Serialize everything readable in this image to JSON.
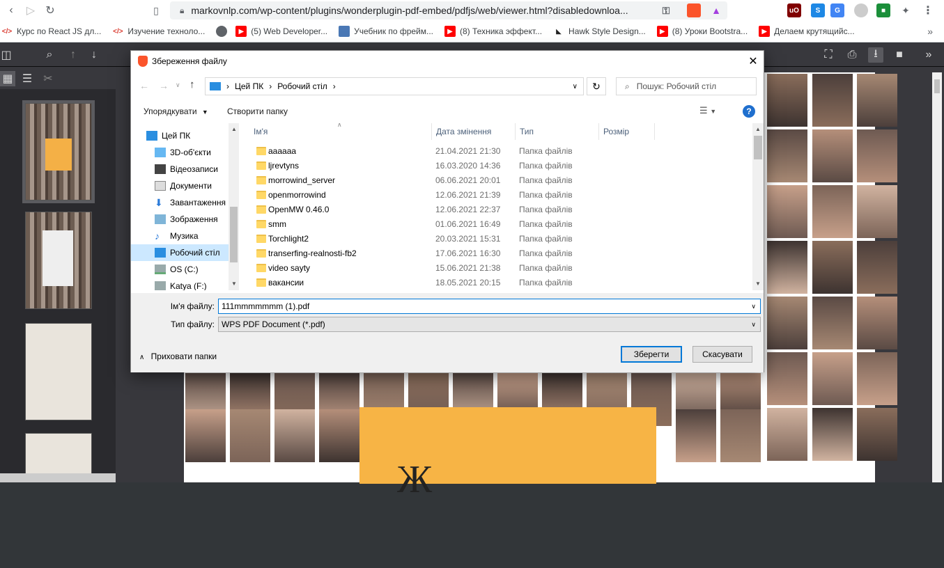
{
  "browser": {
    "url": "markovnlp.com/wp-content/plugins/wonderplugin-pdf-embed/pdfjs/web/viewer.html?disabledownloa..."
  },
  "bookmarks": [
    {
      "label": "Курс по React JS дл...",
      "icon": "code-icon"
    },
    {
      "label": "Изучение техноло...",
      "icon": "code-icon"
    },
    {
      "label": "",
      "icon": "globe-icon"
    },
    {
      "label": "(5) Web Developer...",
      "icon": "youtube-icon"
    },
    {
      "label": "Учебник по фрейм...",
      "icon": "book-icon"
    },
    {
      "label": "(8) Техника эффект...",
      "icon": "youtube-icon"
    },
    {
      "label": "Hawk Style Design...",
      "icon": "hawk-icon"
    },
    {
      "label": "(8) Уроки Bootstra...",
      "icon": "youtube-icon"
    },
    {
      "label": "Делаем крутящийс...",
      "icon": "youtube-icon"
    }
  ],
  "dialog": {
    "title": "Збереження файлу",
    "breadcrumb": [
      "Цей ПК",
      "Робочий стіл"
    ],
    "search_placeholder": "Пошук: Робочий стіл",
    "organize_label": "Упорядкувати",
    "new_folder_label": "Створити папку",
    "nav_items": [
      {
        "label": "Цей ПК",
        "icon": "pc-icon",
        "selected": false,
        "root": true
      },
      {
        "label": "3D-об'єкти",
        "icon": "cube-icon",
        "selected": false
      },
      {
        "label": "Відеозаписи",
        "icon": "video-icon",
        "selected": false
      },
      {
        "label": "Документи",
        "icon": "document-icon",
        "selected": false
      },
      {
        "label": "Завантаження",
        "icon": "download-icon",
        "selected": false
      },
      {
        "label": "Зображення",
        "icon": "image-icon",
        "selected": false
      },
      {
        "label": "Музика",
        "icon": "music-icon",
        "selected": false
      },
      {
        "label": "Робочий стіл",
        "icon": "desktop-icon",
        "selected": true
      },
      {
        "label": "OS (C:)",
        "icon": "drive-icon",
        "selected": false
      },
      {
        "label": "Katya (F:)",
        "icon": "drive-icon",
        "selected": false
      }
    ],
    "columns": {
      "name": "Ім'я",
      "date": "Дата змінення",
      "type": "Тип",
      "size": "Розмір"
    },
    "files": [
      {
        "name": "аааааа",
        "date": "21.04.2021 21:30",
        "type": "Папка файлів"
      },
      {
        "name": "ljrevtyns",
        "date": "16.03.2020 14:36",
        "type": "Папка файлів"
      },
      {
        "name": "morrowind_server",
        "date": "06.06.2021 20:01",
        "type": "Папка файлів"
      },
      {
        "name": "openmorrowind",
        "date": "12.06.2021 21:39",
        "type": "Папка файлів"
      },
      {
        "name": "OpenMW 0.46.0",
        "date": "12.06.2021 22:37",
        "type": "Папка файлів"
      },
      {
        "name": "smm",
        "date": "01.06.2021 16:49",
        "type": "Папка файлів"
      },
      {
        "name": "Torchlight2",
        "date": "20.03.2021 15:31",
        "type": "Папка файлів"
      },
      {
        "name": "transerfing-realnosti-fb2",
        "date": "17.06.2021 16:30",
        "type": "Папка файлів"
      },
      {
        "name": "video sayty",
        "date": "15.06.2021 21:38",
        "type": "Папка файлів"
      },
      {
        "name": "вакансии",
        "date": "18.05.2021 20:15",
        "type": "Папка файлів"
      }
    ],
    "filename_label": "Ім'я файлу:",
    "filename_value": "111mmmmmmm (1).pdf",
    "filetype_label": "Тип файлу:",
    "filetype_value": "WPS PDF Document (*.pdf)",
    "hide_folders_label": "Приховати папки",
    "save_label": "Зберегти",
    "cancel_label": "Скасувати"
  },
  "pdf": {
    "cover_letter": "Ж"
  }
}
